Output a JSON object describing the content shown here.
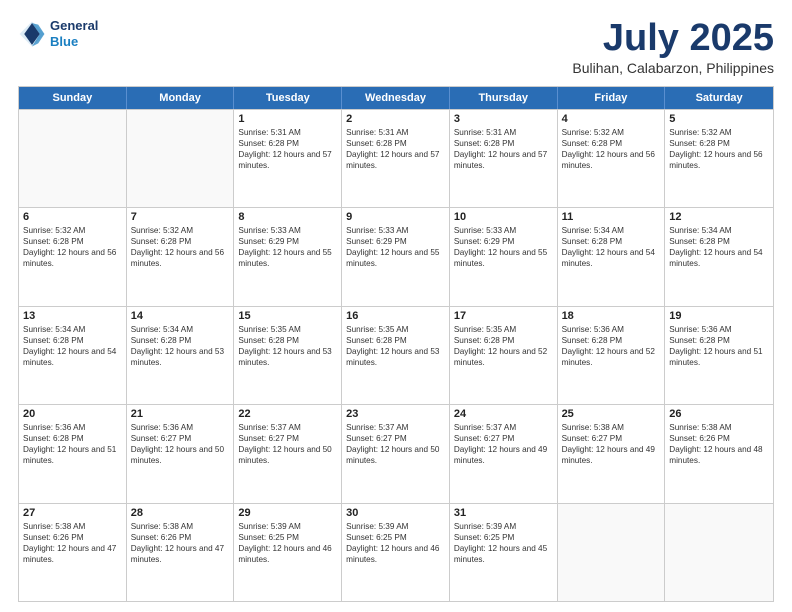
{
  "logo": {
    "line1": "General",
    "line2": "Blue"
  },
  "title": "July 2025",
  "subtitle": "Bulihan, Calabarzon, Philippines",
  "days_of_week": [
    "Sunday",
    "Monday",
    "Tuesday",
    "Wednesday",
    "Thursday",
    "Friday",
    "Saturday"
  ],
  "weeks": [
    [
      {
        "day": "",
        "empty": true
      },
      {
        "day": "",
        "empty": true
      },
      {
        "day": "1",
        "sunrise": "Sunrise: 5:31 AM",
        "sunset": "Sunset: 6:28 PM",
        "daylight": "Daylight: 12 hours and 57 minutes."
      },
      {
        "day": "2",
        "sunrise": "Sunrise: 5:31 AM",
        "sunset": "Sunset: 6:28 PM",
        "daylight": "Daylight: 12 hours and 57 minutes."
      },
      {
        "day": "3",
        "sunrise": "Sunrise: 5:31 AM",
        "sunset": "Sunset: 6:28 PM",
        "daylight": "Daylight: 12 hours and 57 minutes."
      },
      {
        "day": "4",
        "sunrise": "Sunrise: 5:32 AM",
        "sunset": "Sunset: 6:28 PM",
        "daylight": "Daylight: 12 hours and 56 minutes."
      },
      {
        "day": "5",
        "sunrise": "Sunrise: 5:32 AM",
        "sunset": "Sunset: 6:28 PM",
        "daylight": "Daylight: 12 hours and 56 minutes."
      }
    ],
    [
      {
        "day": "6",
        "sunrise": "Sunrise: 5:32 AM",
        "sunset": "Sunset: 6:28 PM",
        "daylight": "Daylight: 12 hours and 56 minutes."
      },
      {
        "day": "7",
        "sunrise": "Sunrise: 5:32 AM",
        "sunset": "Sunset: 6:28 PM",
        "daylight": "Daylight: 12 hours and 56 minutes."
      },
      {
        "day": "8",
        "sunrise": "Sunrise: 5:33 AM",
        "sunset": "Sunset: 6:29 PM",
        "daylight": "Daylight: 12 hours and 55 minutes."
      },
      {
        "day": "9",
        "sunrise": "Sunrise: 5:33 AM",
        "sunset": "Sunset: 6:29 PM",
        "daylight": "Daylight: 12 hours and 55 minutes."
      },
      {
        "day": "10",
        "sunrise": "Sunrise: 5:33 AM",
        "sunset": "Sunset: 6:29 PM",
        "daylight": "Daylight: 12 hours and 55 minutes."
      },
      {
        "day": "11",
        "sunrise": "Sunrise: 5:34 AM",
        "sunset": "Sunset: 6:28 PM",
        "daylight": "Daylight: 12 hours and 54 minutes."
      },
      {
        "day": "12",
        "sunrise": "Sunrise: 5:34 AM",
        "sunset": "Sunset: 6:28 PM",
        "daylight": "Daylight: 12 hours and 54 minutes."
      }
    ],
    [
      {
        "day": "13",
        "sunrise": "Sunrise: 5:34 AM",
        "sunset": "Sunset: 6:28 PM",
        "daylight": "Daylight: 12 hours and 54 minutes."
      },
      {
        "day": "14",
        "sunrise": "Sunrise: 5:34 AM",
        "sunset": "Sunset: 6:28 PM",
        "daylight": "Daylight: 12 hours and 53 minutes."
      },
      {
        "day": "15",
        "sunrise": "Sunrise: 5:35 AM",
        "sunset": "Sunset: 6:28 PM",
        "daylight": "Daylight: 12 hours and 53 minutes."
      },
      {
        "day": "16",
        "sunrise": "Sunrise: 5:35 AM",
        "sunset": "Sunset: 6:28 PM",
        "daylight": "Daylight: 12 hours and 53 minutes."
      },
      {
        "day": "17",
        "sunrise": "Sunrise: 5:35 AM",
        "sunset": "Sunset: 6:28 PM",
        "daylight": "Daylight: 12 hours and 52 minutes."
      },
      {
        "day": "18",
        "sunrise": "Sunrise: 5:36 AM",
        "sunset": "Sunset: 6:28 PM",
        "daylight": "Daylight: 12 hours and 52 minutes."
      },
      {
        "day": "19",
        "sunrise": "Sunrise: 5:36 AM",
        "sunset": "Sunset: 6:28 PM",
        "daylight": "Daylight: 12 hours and 51 minutes."
      }
    ],
    [
      {
        "day": "20",
        "sunrise": "Sunrise: 5:36 AM",
        "sunset": "Sunset: 6:28 PM",
        "daylight": "Daylight: 12 hours and 51 minutes."
      },
      {
        "day": "21",
        "sunrise": "Sunrise: 5:36 AM",
        "sunset": "Sunset: 6:27 PM",
        "daylight": "Daylight: 12 hours and 50 minutes."
      },
      {
        "day": "22",
        "sunrise": "Sunrise: 5:37 AM",
        "sunset": "Sunset: 6:27 PM",
        "daylight": "Daylight: 12 hours and 50 minutes."
      },
      {
        "day": "23",
        "sunrise": "Sunrise: 5:37 AM",
        "sunset": "Sunset: 6:27 PM",
        "daylight": "Daylight: 12 hours and 50 minutes."
      },
      {
        "day": "24",
        "sunrise": "Sunrise: 5:37 AM",
        "sunset": "Sunset: 6:27 PM",
        "daylight": "Daylight: 12 hours and 49 minutes."
      },
      {
        "day": "25",
        "sunrise": "Sunrise: 5:38 AM",
        "sunset": "Sunset: 6:27 PM",
        "daylight": "Daylight: 12 hours and 49 minutes."
      },
      {
        "day": "26",
        "sunrise": "Sunrise: 5:38 AM",
        "sunset": "Sunset: 6:26 PM",
        "daylight": "Daylight: 12 hours and 48 minutes."
      }
    ],
    [
      {
        "day": "27",
        "sunrise": "Sunrise: 5:38 AM",
        "sunset": "Sunset: 6:26 PM",
        "daylight": "Daylight: 12 hours and 47 minutes."
      },
      {
        "day": "28",
        "sunrise": "Sunrise: 5:38 AM",
        "sunset": "Sunset: 6:26 PM",
        "daylight": "Daylight: 12 hours and 47 minutes."
      },
      {
        "day": "29",
        "sunrise": "Sunrise: 5:39 AM",
        "sunset": "Sunset: 6:25 PM",
        "daylight": "Daylight: 12 hours and 46 minutes."
      },
      {
        "day": "30",
        "sunrise": "Sunrise: 5:39 AM",
        "sunset": "Sunset: 6:25 PM",
        "daylight": "Daylight: 12 hours and 46 minutes."
      },
      {
        "day": "31",
        "sunrise": "Sunrise: 5:39 AM",
        "sunset": "Sunset: 6:25 PM",
        "daylight": "Daylight: 12 hours and 45 minutes."
      },
      {
        "day": "",
        "empty": true
      },
      {
        "day": "",
        "empty": true
      }
    ]
  ]
}
